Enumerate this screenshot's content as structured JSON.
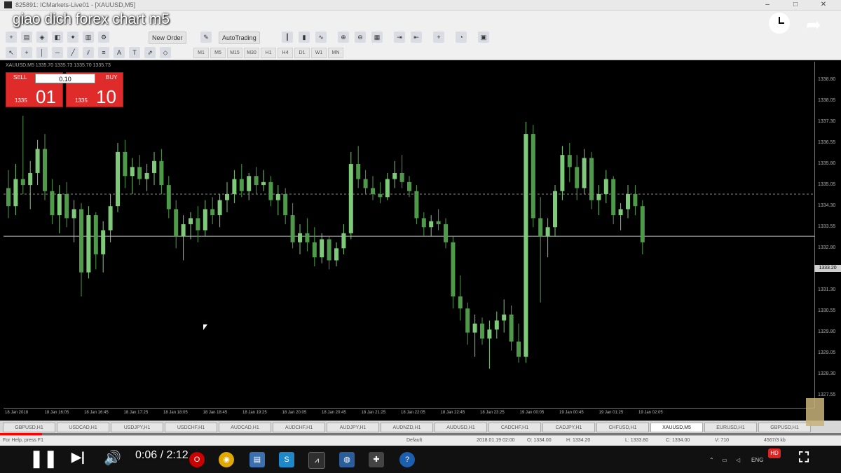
{
  "window": {
    "title": "825891: ICMarkets-Live01 - [XAUUSD,M5]"
  },
  "video": {
    "title": "giao dich forex chart m5",
    "current_time": "0:06 / 2:12",
    "progress": 0.05
  },
  "toolbar": {
    "new_order": "New Order",
    "auto_trading": "AutoTrading",
    "timeframes": [
      "M1",
      "M5",
      "M15",
      "M30",
      "H1",
      "H4",
      "D1",
      "W1",
      "MN"
    ]
  },
  "chart": {
    "symbol_info": "XAUUSD,M5  1335.70 1335.73 1335.70 1335.73",
    "one_click": {
      "sell_label": "SELL",
      "buy_label": "BUY",
      "lot": "0.10",
      "sell_small": "1335",
      "sell_big": "01",
      "buy_small": "1335",
      "buy_big": "10"
    },
    "price_labels": [
      "1338.80",
      "1338.05",
      "1337.30",
      "1336.55",
      "1335.80",
      "1335.05",
      "1334.30",
      "1333.55",
      "1332.80",
      "1332.05",
      "1331.30",
      "1330.55",
      "1329.80",
      "1329.05",
      "1328.30",
      "1327.55"
    ],
    "current_price": "1333.20",
    "time_labels": [
      "18 Jan 2018",
      "18 Jan 16:05",
      "18 Jan 16:45",
      "18 Jan 17:25",
      "18 Jan 18:05",
      "18 Jan 18:45",
      "18 Jan 19:25",
      "18 Jan 20:05",
      "18 Jan 20:45",
      "18 Jan 21:25",
      "18 Jan 22:05",
      "18 Jan 22:45",
      "18 Jan 23:25",
      "19 Jan 00:05",
      "19 Jan 00:45",
      "19 Jan 01:25",
      "19 Jan 02:05"
    ]
  },
  "chart_data": {
    "type": "candlestick",
    "symbol": "XAUUSD",
    "timeframe": "M5",
    "ylim": [
      1327.5,
      1339.0
    ],
    "reference_line": 1334.6,
    "bid_line": 1333.2,
    "colors": {
      "bull": "#7fc97a",
      "bear": "#4f9a4a",
      "background": "#000000"
    },
    "candles": [
      {
        "o": 1334.8,
        "h": 1335.4,
        "l": 1333.8,
        "c": 1334.2
      },
      {
        "o": 1334.2,
        "h": 1335.6,
        "l": 1333.9,
        "c": 1335.1
      },
      {
        "o": 1335.1,
        "h": 1337.2,
        "l": 1334.6,
        "c": 1334.9
      },
      {
        "o": 1334.9,
        "h": 1335.7,
        "l": 1334.1,
        "c": 1335.3
      },
      {
        "o": 1335.3,
        "h": 1336.4,
        "l": 1334.9,
        "c": 1336.1
      },
      {
        "o": 1336.1,
        "h": 1336.6,
        "l": 1334.4,
        "c": 1334.7
      },
      {
        "o": 1334.7,
        "h": 1335.1,
        "l": 1333.6,
        "c": 1333.9
      },
      {
        "o": 1333.9,
        "h": 1334.9,
        "l": 1333.3,
        "c": 1334.6
      },
      {
        "o": 1334.6,
        "h": 1335.0,
        "l": 1333.5,
        "c": 1333.8
      },
      {
        "o": 1333.8,
        "h": 1334.4,
        "l": 1333.0,
        "c": 1334.1
      },
      {
        "o": 1334.1,
        "h": 1334.3,
        "l": 1331.2,
        "c": 1332.0
      },
      {
        "o": 1332.0,
        "h": 1334.2,
        "l": 1331.8,
        "c": 1333.9
      },
      {
        "o": 1333.9,
        "h": 1334.0,
        "l": 1332.1,
        "c": 1332.6
      },
      {
        "o": 1332.6,
        "h": 1333.7,
        "l": 1332.0,
        "c": 1333.4
      },
      {
        "o": 1333.4,
        "h": 1334.6,
        "l": 1333.0,
        "c": 1334.2
      },
      {
        "o": 1334.2,
        "h": 1336.3,
        "l": 1334.0,
        "c": 1336.0
      },
      {
        "o": 1336.0,
        "h": 1336.4,
        "l": 1334.8,
        "c": 1335.2
      },
      {
        "o": 1335.2,
        "h": 1335.8,
        "l": 1334.6,
        "c": 1335.5
      },
      {
        "o": 1335.5,
        "h": 1335.9,
        "l": 1334.9,
        "c": 1335.1
      },
      {
        "o": 1335.1,
        "h": 1335.6,
        "l": 1334.7,
        "c": 1335.3
      },
      {
        "o": 1335.3,
        "h": 1336.0,
        "l": 1334.9,
        "c": 1335.7
      },
      {
        "o": 1335.7,
        "h": 1336.1,
        "l": 1334.6,
        "c": 1334.9
      },
      {
        "o": 1334.9,
        "h": 1335.2,
        "l": 1333.8,
        "c": 1334.1
      },
      {
        "o": 1334.1,
        "h": 1334.4,
        "l": 1332.8,
        "c": 1333.2
      },
      {
        "o": 1333.2,
        "h": 1333.9,
        "l": 1332.4,
        "c": 1333.6
      },
      {
        "o": 1333.6,
        "h": 1334.0,
        "l": 1333.1,
        "c": 1333.8
      },
      {
        "o": 1333.8,
        "h": 1334.2,
        "l": 1333.0,
        "c": 1333.4
      },
      {
        "o": 1333.4,
        "h": 1334.4,
        "l": 1333.2,
        "c": 1334.1
      },
      {
        "o": 1334.1,
        "h": 1334.5,
        "l": 1333.6,
        "c": 1333.9
      },
      {
        "o": 1333.9,
        "h": 1334.6,
        "l": 1333.5,
        "c": 1334.4
      },
      {
        "o": 1334.4,
        "h": 1335.0,
        "l": 1334.0,
        "c": 1334.6
      },
      {
        "o": 1334.6,
        "h": 1335.4,
        "l": 1334.3,
        "c": 1335.1
      },
      {
        "o": 1335.1,
        "h": 1335.6,
        "l": 1334.5,
        "c": 1334.7
      },
      {
        "o": 1334.7,
        "h": 1335.3,
        "l": 1334.4,
        "c": 1335.2
      },
      {
        "o": 1335.2,
        "h": 1335.5,
        "l": 1334.6,
        "c": 1334.9
      },
      {
        "o": 1334.9,
        "h": 1335.4,
        "l": 1334.7,
        "c": 1335.0
      },
      {
        "o": 1335.0,
        "h": 1335.2,
        "l": 1334.2,
        "c": 1334.4
      },
      {
        "o": 1334.4,
        "h": 1334.9,
        "l": 1333.9,
        "c": 1334.6
      },
      {
        "o": 1334.6,
        "h": 1334.8,
        "l": 1333.6,
        "c": 1333.9
      },
      {
        "o": 1333.9,
        "h": 1334.3,
        "l": 1332.8,
        "c": 1333.0
      },
      {
        "o": 1333.0,
        "h": 1333.6,
        "l": 1332.6,
        "c": 1333.3
      },
      {
        "o": 1333.3,
        "h": 1333.8,
        "l": 1332.7,
        "c": 1333.0
      },
      {
        "o": 1333.0,
        "h": 1333.5,
        "l": 1332.2,
        "c": 1332.5
      },
      {
        "o": 1332.5,
        "h": 1333.3,
        "l": 1332.3,
        "c": 1333.1
      },
      {
        "o": 1333.1,
        "h": 1333.2,
        "l": 1332.1,
        "c": 1332.4
      },
      {
        "o": 1332.4,
        "h": 1333.0,
        "l": 1332.2,
        "c": 1332.8
      },
      {
        "o": 1332.8,
        "h": 1333.6,
        "l": 1332.6,
        "c": 1333.3
      },
      {
        "o": 1333.3,
        "h": 1336.0,
        "l": 1333.1,
        "c": 1335.6
      },
      {
        "o": 1335.6,
        "h": 1336.2,
        "l": 1334.8,
        "c": 1335.1
      },
      {
        "o": 1335.1,
        "h": 1335.4,
        "l": 1334.6,
        "c": 1334.8
      },
      {
        "o": 1334.8,
        "h": 1335.2,
        "l": 1334.4,
        "c": 1334.6
      },
      {
        "o": 1334.6,
        "h": 1335.0,
        "l": 1334.3,
        "c": 1334.5
      },
      {
        "o": 1334.5,
        "h": 1335.3,
        "l": 1334.4,
        "c": 1335.1
      },
      {
        "o": 1335.1,
        "h": 1335.7,
        "l": 1334.8,
        "c": 1335.3
      },
      {
        "o": 1335.3,
        "h": 1335.9,
        "l": 1334.8,
        "c": 1335.0
      },
      {
        "o": 1335.0,
        "h": 1335.2,
        "l": 1334.5,
        "c": 1334.7
      },
      {
        "o": 1334.7,
        "h": 1334.9,
        "l": 1333.6,
        "c": 1333.8
      },
      {
        "o": 1333.8,
        "h": 1334.0,
        "l": 1333.2,
        "c": 1333.5
      },
      {
        "o": 1333.5,
        "h": 1333.9,
        "l": 1333.2,
        "c": 1333.7
      },
      {
        "o": 1333.7,
        "h": 1334.1,
        "l": 1333.4,
        "c": 1333.6
      },
      {
        "o": 1333.6,
        "h": 1333.8,
        "l": 1332.8,
        "c": 1333.0
      },
      {
        "o": 1333.0,
        "h": 1333.2,
        "l": 1330.8,
        "c": 1331.2
      },
      {
        "o": 1331.2,
        "h": 1331.9,
        "l": 1330.4,
        "c": 1330.8
      },
      {
        "o": 1330.8,
        "h": 1331.0,
        "l": 1329.6,
        "c": 1330.0
      },
      {
        "o": 1330.0,
        "h": 1330.6,
        "l": 1329.2,
        "c": 1330.3
      },
      {
        "o": 1330.3,
        "h": 1330.5,
        "l": 1329.6,
        "c": 1329.8
      },
      {
        "o": 1329.8,
        "h": 1330.4,
        "l": 1328.8,
        "c": 1330.1
      },
      {
        "o": 1330.1,
        "h": 1330.7,
        "l": 1329.8,
        "c": 1330.4
      },
      {
        "o": 1330.4,
        "h": 1331.1,
        "l": 1330.0,
        "c": 1330.6
      },
      {
        "o": 1330.6,
        "h": 1330.9,
        "l": 1329.4,
        "c": 1329.7
      },
      {
        "o": 1329.7,
        "h": 1330.3,
        "l": 1329.0,
        "c": 1329.2
      },
      {
        "o": 1329.2,
        "h": 1337.0,
        "l": 1329.0,
        "c": 1336.6
      },
      {
        "o": 1336.6,
        "h": 1336.9,
        "l": 1333.5,
        "c": 1333.8
      },
      {
        "o": 1333.8,
        "h": 1334.5,
        "l": 1331.0,
        "c": 1333.2
      },
      {
        "o": 1333.2,
        "h": 1333.8,
        "l": 1332.5,
        "c": 1333.5
      },
      {
        "o": 1333.5,
        "h": 1334.9,
        "l": 1333.2,
        "c": 1334.7
      },
      {
        "o": 1334.7,
        "h": 1336.2,
        "l": 1334.4,
        "c": 1335.9
      },
      {
        "o": 1335.9,
        "h": 1336.3,
        "l": 1335.0,
        "c": 1335.5
      },
      {
        "o": 1335.5,
        "h": 1335.9,
        "l": 1334.4,
        "c": 1334.8
      },
      {
        "o": 1334.8,
        "h": 1336.1,
        "l": 1334.6,
        "c": 1335.8
      },
      {
        "o": 1335.8,
        "h": 1336.0,
        "l": 1334.1,
        "c": 1334.4
      },
      {
        "o": 1334.4,
        "h": 1334.9,
        "l": 1333.9,
        "c": 1334.6
      },
      {
        "o": 1334.6,
        "h": 1335.4,
        "l": 1334.3,
        "c": 1335.1
      },
      {
        "o": 1335.1,
        "h": 1335.2,
        "l": 1333.6,
        "c": 1333.9
      },
      {
        "o": 1333.9,
        "h": 1334.3,
        "l": 1333.4,
        "c": 1334.1
      },
      {
        "o": 1334.1,
        "h": 1334.9,
        "l": 1333.8,
        "c": 1334.6
      },
      {
        "o": 1334.6,
        "h": 1334.9,
        "l": 1333.9,
        "c": 1334.2
      },
      {
        "o": 1334.2,
        "h": 1334.4,
        "l": 1332.6,
        "c": 1333.0
      }
    ]
  },
  "tabs": [
    "GBPUSD,H1",
    "USDCAD,H1",
    "USDJPY,H1",
    "USDCHF,H1",
    "AUDCAD,H1",
    "AUDCHF,H1",
    "AUDJPY,H1",
    "AUDNZD,H1",
    "AUDUSD,H1",
    "CADCHF,H1",
    "CADJPY,H1",
    "CHFUSD,H1",
    "XAUUSD,M5",
    "EURUSD,H1",
    "GBPUSD,H1"
  ],
  "active_tab": 12,
  "status": {
    "help": "For Help, press F1",
    "profile": "Default",
    "datetime": "2018.01.19 02:00",
    "open": "O: 1334.00",
    "high": "H: 1334.20",
    "low": "L: 1333.80",
    "close": "C: 1334.00",
    "volume": "V: 710",
    "traffic": "4567/3 kb"
  },
  "taskbar": {
    "icons": [
      "pause-icon",
      "skip-next-icon",
      "volume-icon",
      "opera-icon",
      "chrome-icon",
      "file-explorer-icon",
      "skype-icon",
      "metatrader-icon",
      "network-icon",
      "puzzle-icon",
      "help-icon"
    ],
    "tray_lang": "ENG"
  }
}
